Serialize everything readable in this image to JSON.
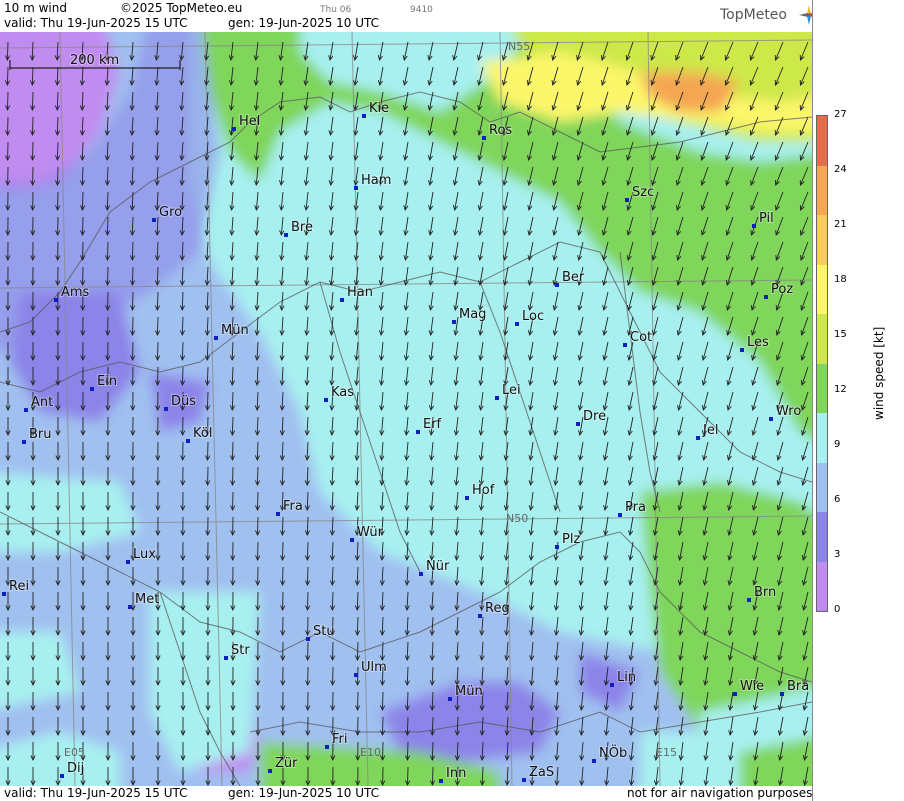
{
  "header": {
    "title": "10 m wind",
    "copyright": "©2025 TopMeteo.eu",
    "valid": "valid:  Thu  19-Jun-2025  15 UTC",
    "generated": "gen: 19-Jun-2025 10 UTC",
    "run_small": "Thu 06",
    "run_code": "9410",
    "logo": "TopMeteo"
  },
  "footer": {
    "valid": "valid:  Thu  19-Jun-2025  15 UTC",
    "generated": "gen: 19-Jun-2025 10 UTC",
    "disclaimer": "not for air navigation purposes"
  },
  "map": {
    "scale_label": "200 km",
    "grid_labels": [
      "N55",
      "N50",
      "E05",
      "E10",
      "E15"
    ],
    "cities": [
      "Hel",
      "Kie",
      "Ros",
      "Ham",
      "Szc",
      "Gro",
      "Bre",
      "Pil",
      "Ber",
      "Ams",
      "Han",
      "Poz",
      "Mag",
      "Loc",
      "Mün",
      "Cot",
      "Les",
      "Ein",
      "Lei",
      "Ant",
      "Düs",
      "Kas",
      "Dre",
      "Wro",
      "Bru",
      "Köl",
      "Erf",
      "Jel",
      "Hof",
      "Fra",
      "Pra",
      "N50",
      "Wür",
      "Plz",
      "Lux",
      "Nür",
      "Rei",
      "Met",
      "Reg",
      "Brn",
      "Stu",
      "Str",
      "Ulm",
      "Lin",
      "Mün",
      "Wie",
      "Bra",
      "Fri",
      "Zür",
      "Dij",
      "Inn",
      "ZaS",
      "NÖb"
    ]
  },
  "legend": {
    "title": "wind speed  [kt]",
    "ticks": [
      "27",
      "24",
      "21",
      "18",
      "15",
      "12",
      "9",
      "6",
      "3",
      "0"
    ],
    "colors": [
      "#e76a4c",
      "#f5a653",
      "#f7cd58",
      "#fbf66a",
      "#cde84a",
      "#7fd65a",
      "#a8f0f0",
      "#a0c0f0",
      "#8c84e8",
      "#c08cf0"
    ]
  }
}
